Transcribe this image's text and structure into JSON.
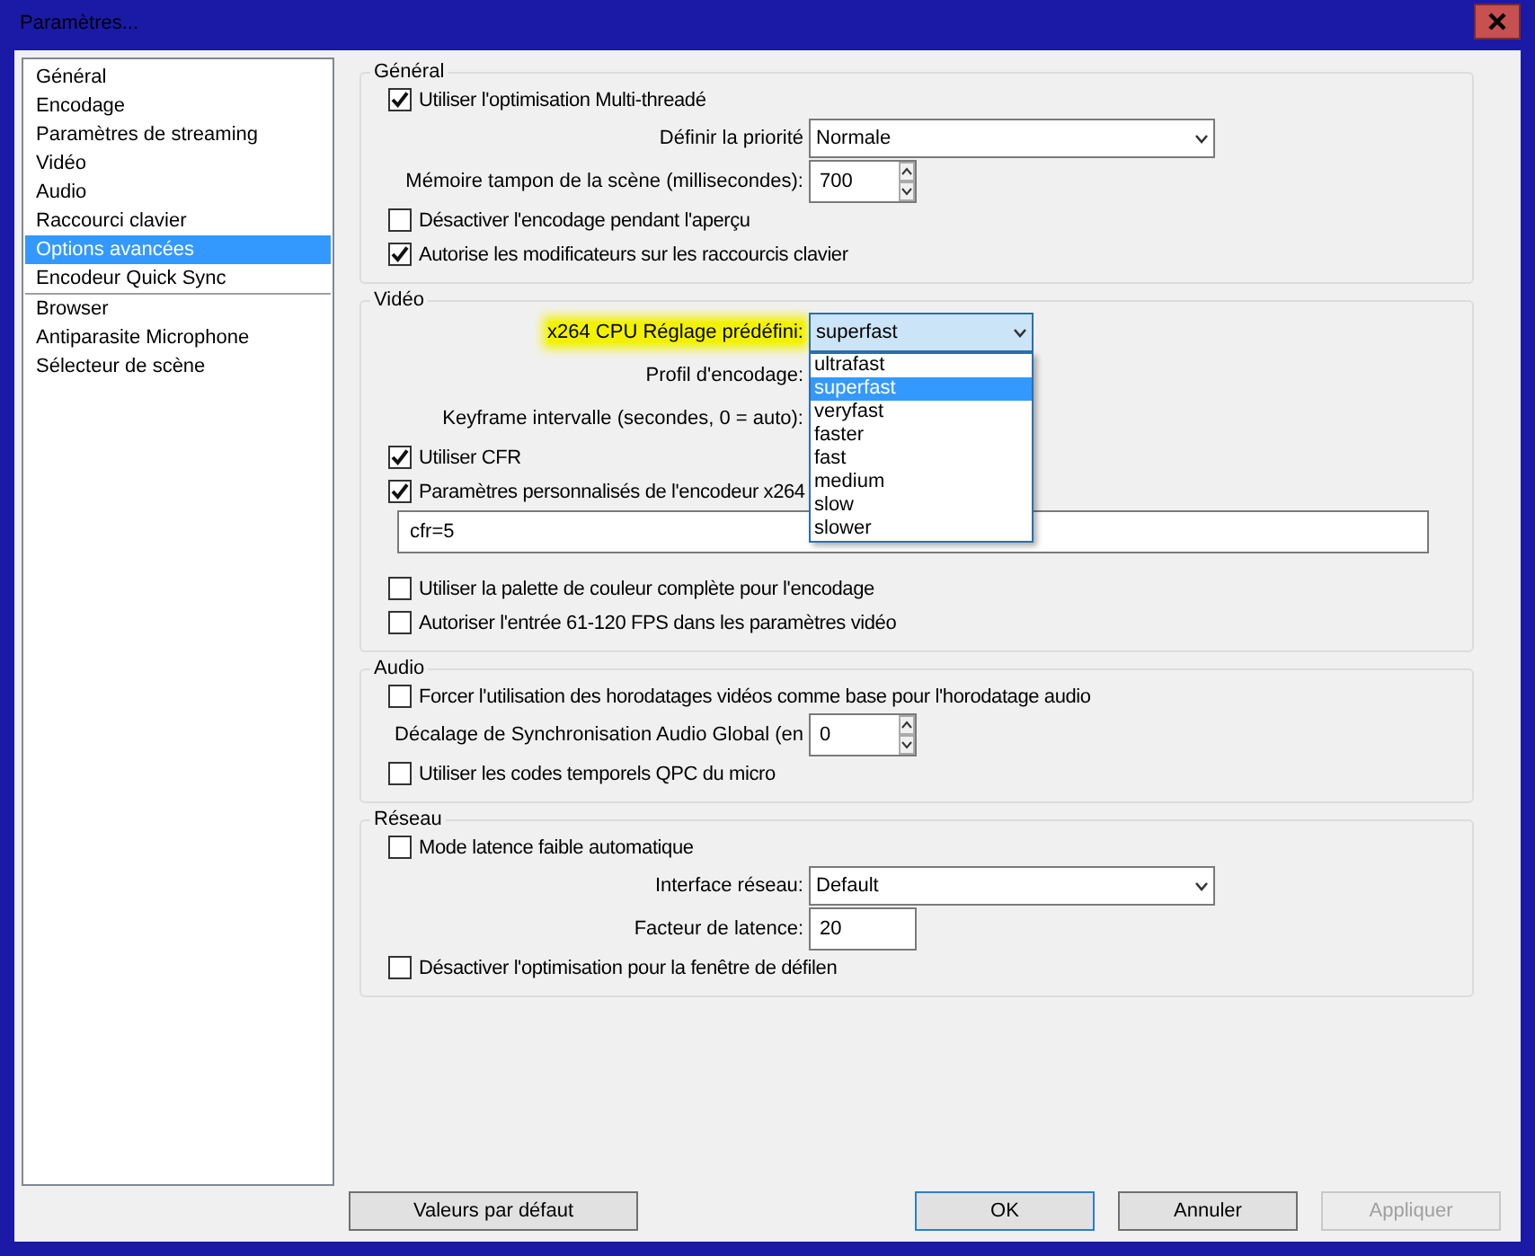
{
  "window": {
    "title": "Paramètres..."
  },
  "sidebar": {
    "items": [
      {
        "label": "Général",
        "selected": false,
        "separator_after": false
      },
      {
        "label": "Encodage",
        "selected": false,
        "separator_after": false
      },
      {
        "label": "Paramètres de streaming",
        "selected": false,
        "separator_after": false
      },
      {
        "label": "Vidéo",
        "selected": false,
        "separator_after": false
      },
      {
        "label": "Audio",
        "selected": false,
        "separator_after": false
      },
      {
        "label": "Raccourci clavier",
        "selected": false,
        "separator_after": false
      },
      {
        "label": "Options avancées",
        "selected": true,
        "separator_after": false
      },
      {
        "label": "Encodeur Quick Sync",
        "selected": false,
        "separator_after": true
      },
      {
        "label": "Browser",
        "selected": false,
        "separator_after": false
      },
      {
        "label": "Antiparasite Microphone",
        "selected": false,
        "separator_after": false
      },
      {
        "label": "Sélecteur de scène",
        "selected": false,
        "separator_after": false
      }
    ]
  },
  "groups": [
    {
      "title": "Général",
      "rows": [
        {
          "kind": "checkbox",
          "label": "Utiliser l'optimisation Multi-threadé",
          "checked": true
        },
        {
          "kind": "select",
          "label": "Définir la priorité",
          "value": "Normale"
        },
        {
          "kind": "spin",
          "label": "Mémoire tampon de la scène (millisecondes):",
          "value": "700"
        },
        {
          "kind": "checkbox",
          "label": "Désactiver l'encodage pendant l'aperçu",
          "checked": false
        },
        {
          "kind": "checkbox",
          "label": "Autorise les modificateurs sur les raccourcis clavier",
          "checked": true
        }
      ]
    },
    {
      "title": "Vidéo",
      "rows": [
        {
          "kind": "select",
          "label": "x264 CPU Réglage prédéfini:",
          "value": "superfast",
          "highlighted": true,
          "open": true,
          "options": [
            {
              "label": "ultrafast",
              "selected": false
            },
            {
              "label": "superfast",
              "selected": true
            },
            {
              "label": "veryfast",
              "selected": false
            },
            {
              "label": "faster",
              "selected": false
            },
            {
              "label": "fast",
              "selected": false
            },
            {
              "label": "medium",
              "selected": false
            },
            {
              "label": "slow",
              "selected": false
            },
            {
              "label": "slower",
              "selected": false
            }
          ]
        },
        {
          "kind": "label",
          "label": "Profil d'encodage:"
        },
        {
          "kind": "label",
          "label": "Keyframe intervalle (secondes, 0 = auto):"
        },
        {
          "kind": "checkbox",
          "label": "Utiliser CFR",
          "checked": true
        },
        {
          "kind": "checkbox",
          "label": "Paramètres personnalisés de l'encodeur x264",
          "checked": true
        },
        {
          "kind": "wide-text",
          "value": "cfr=5"
        },
        {
          "kind": "checkbox",
          "label": "Utiliser la palette de couleur complète pour l'encodage",
          "checked": false
        },
        {
          "kind": "checkbox",
          "label": "Autoriser l'entrée 61-120 FPS dans les paramètres vidéo",
          "checked": false
        }
      ]
    },
    {
      "title": "Audio",
      "rows": [
        {
          "kind": "checkbox",
          "label": "Forcer l'utilisation des horodatages vidéos comme base pour l'horodatage audio",
          "checked": false
        },
        {
          "kind": "spin",
          "label": "Décalage de Synchronisation Audio Global (en",
          "value": "0"
        },
        {
          "kind": "checkbox",
          "label": "Utiliser les codes temporels QPC du micro",
          "checked": false
        }
      ]
    },
    {
      "title": "Réseau",
      "rows": [
        {
          "kind": "checkbox",
          "label": "Mode latence faible automatique",
          "checked": false
        },
        {
          "kind": "select",
          "label": "Interface réseau:",
          "value": "Default"
        },
        {
          "kind": "text",
          "label": "Facteur de latence:",
          "value": "20"
        },
        {
          "kind": "checkbox",
          "label": "Désactiver l'optimisation pour la fenêtre de défilen",
          "checked": false
        }
      ]
    }
  ],
  "left_buttons": [
    {
      "label": "Valeurs par défaut",
      "default": false,
      "disabled": false
    }
  ],
  "right_buttons": [
    {
      "label": "OK",
      "default": true,
      "disabled": false
    },
    {
      "label": "Annuler",
      "default": false,
      "disabled": false
    },
    {
      "label": "Appliquer",
      "default": false,
      "disabled": true
    }
  ]
}
